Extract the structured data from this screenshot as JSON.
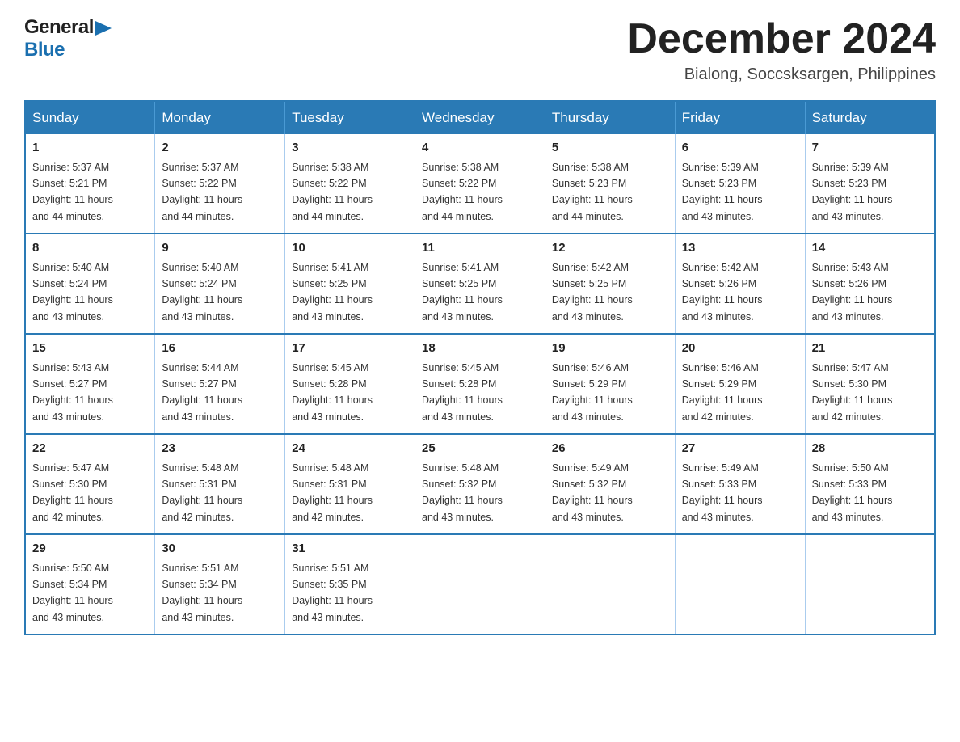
{
  "header": {
    "logo": {
      "general": "General",
      "blue": "Blue",
      "arrow_color": "#1a6faf"
    },
    "title": "December 2024",
    "location": "Bialong, Soccsksargen, Philippines"
  },
  "calendar": {
    "days_of_week": [
      "Sunday",
      "Monday",
      "Tuesday",
      "Wednesday",
      "Thursday",
      "Friday",
      "Saturday"
    ],
    "weeks": [
      [
        {
          "day": "1",
          "sunrise": "5:37 AM",
          "sunset": "5:21 PM",
          "daylight": "11 hours and 44 minutes."
        },
        {
          "day": "2",
          "sunrise": "5:37 AM",
          "sunset": "5:22 PM",
          "daylight": "11 hours and 44 minutes."
        },
        {
          "day": "3",
          "sunrise": "5:38 AM",
          "sunset": "5:22 PM",
          "daylight": "11 hours and 44 minutes."
        },
        {
          "day": "4",
          "sunrise": "5:38 AM",
          "sunset": "5:22 PM",
          "daylight": "11 hours and 44 minutes."
        },
        {
          "day": "5",
          "sunrise": "5:38 AM",
          "sunset": "5:23 PM",
          "daylight": "11 hours and 44 minutes."
        },
        {
          "day": "6",
          "sunrise": "5:39 AM",
          "sunset": "5:23 PM",
          "daylight": "11 hours and 43 minutes."
        },
        {
          "day": "7",
          "sunrise": "5:39 AM",
          "sunset": "5:23 PM",
          "daylight": "11 hours and 43 minutes."
        }
      ],
      [
        {
          "day": "8",
          "sunrise": "5:40 AM",
          "sunset": "5:24 PM",
          "daylight": "11 hours and 43 minutes."
        },
        {
          "day": "9",
          "sunrise": "5:40 AM",
          "sunset": "5:24 PM",
          "daylight": "11 hours and 43 minutes."
        },
        {
          "day": "10",
          "sunrise": "5:41 AM",
          "sunset": "5:25 PM",
          "daylight": "11 hours and 43 minutes."
        },
        {
          "day": "11",
          "sunrise": "5:41 AM",
          "sunset": "5:25 PM",
          "daylight": "11 hours and 43 minutes."
        },
        {
          "day": "12",
          "sunrise": "5:42 AM",
          "sunset": "5:25 PM",
          "daylight": "11 hours and 43 minutes."
        },
        {
          "day": "13",
          "sunrise": "5:42 AM",
          "sunset": "5:26 PM",
          "daylight": "11 hours and 43 minutes."
        },
        {
          "day": "14",
          "sunrise": "5:43 AM",
          "sunset": "5:26 PM",
          "daylight": "11 hours and 43 minutes."
        }
      ],
      [
        {
          "day": "15",
          "sunrise": "5:43 AM",
          "sunset": "5:27 PM",
          "daylight": "11 hours and 43 minutes."
        },
        {
          "day": "16",
          "sunrise": "5:44 AM",
          "sunset": "5:27 PM",
          "daylight": "11 hours and 43 minutes."
        },
        {
          "day": "17",
          "sunrise": "5:45 AM",
          "sunset": "5:28 PM",
          "daylight": "11 hours and 43 minutes."
        },
        {
          "day": "18",
          "sunrise": "5:45 AM",
          "sunset": "5:28 PM",
          "daylight": "11 hours and 43 minutes."
        },
        {
          "day": "19",
          "sunrise": "5:46 AM",
          "sunset": "5:29 PM",
          "daylight": "11 hours and 43 minutes."
        },
        {
          "day": "20",
          "sunrise": "5:46 AM",
          "sunset": "5:29 PM",
          "daylight": "11 hours and 42 minutes."
        },
        {
          "day": "21",
          "sunrise": "5:47 AM",
          "sunset": "5:30 PM",
          "daylight": "11 hours and 42 minutes."
        }
      ],
      [
        {
          "day": "22",
          "sunrise": "5:47 AM",
          "sunset": "5:30 PM",
          "daylight": "11 hours and 42 minutes."
        },
        {
          "day": "23",
          "sunrise": "5:48 AM",
          "sunset": "5:31 PM",
          "daylight": "11 hours and 42 minutes."
        },
        {
          "day": "24",
          "sunrise": "5:48 AM",
          "sunset": "5:31 PM",
          "daylight": "11 hours and 42 minutes."
        },
        {
          "day": "25",
          "sunrise": "5:48 AM",
          "sunset": "5:32 PM",
          "daylight": "11 hours and 43 minutes."
        },
        {
          "day": "26",
          "sunrise": "5:49 AM",
          "sunset": "5:32 PM",
          "daylight": "11 hours and 43 minutes."
        },
        {
          "day": "27",
          "sunrise": "5:49 AM",
          "sunset": "5:33 PM",
          "daylight": "11 hours and 43 minutes."
        },
        {
          "day": "28",
          "sunrise": "5:50 AM",
          "sunset": "5:33 PM",
          "daylight": "11 hours and 43 minutes."
        }
      ],
      [
        {
          "day": "29",
          "sunrise": "5:50 AM",
          "sunset": "5:34 PM",
          "daylight": "11 hours and 43 minutes."
        },
        {
          "day": "30",
          "sunrise": "5:51 AM",
          "sunset": "5:34 PM",
          "daylight": "11 hours and 43 minutes."
        },
        {
          "day": "31",
          "sunrise": "5:51 AM",
          "sunset": "5:35 PM",
          "daylight": "11 hours and 43 minutes."
        },
        null,
        null,
        null,
        null
      ]
    ],
    "labels": {
      "sunrise": "Sunrise:",
      "sunset": "Sunset:",
      "daylight": "Daylight:"
    }
  }
}
